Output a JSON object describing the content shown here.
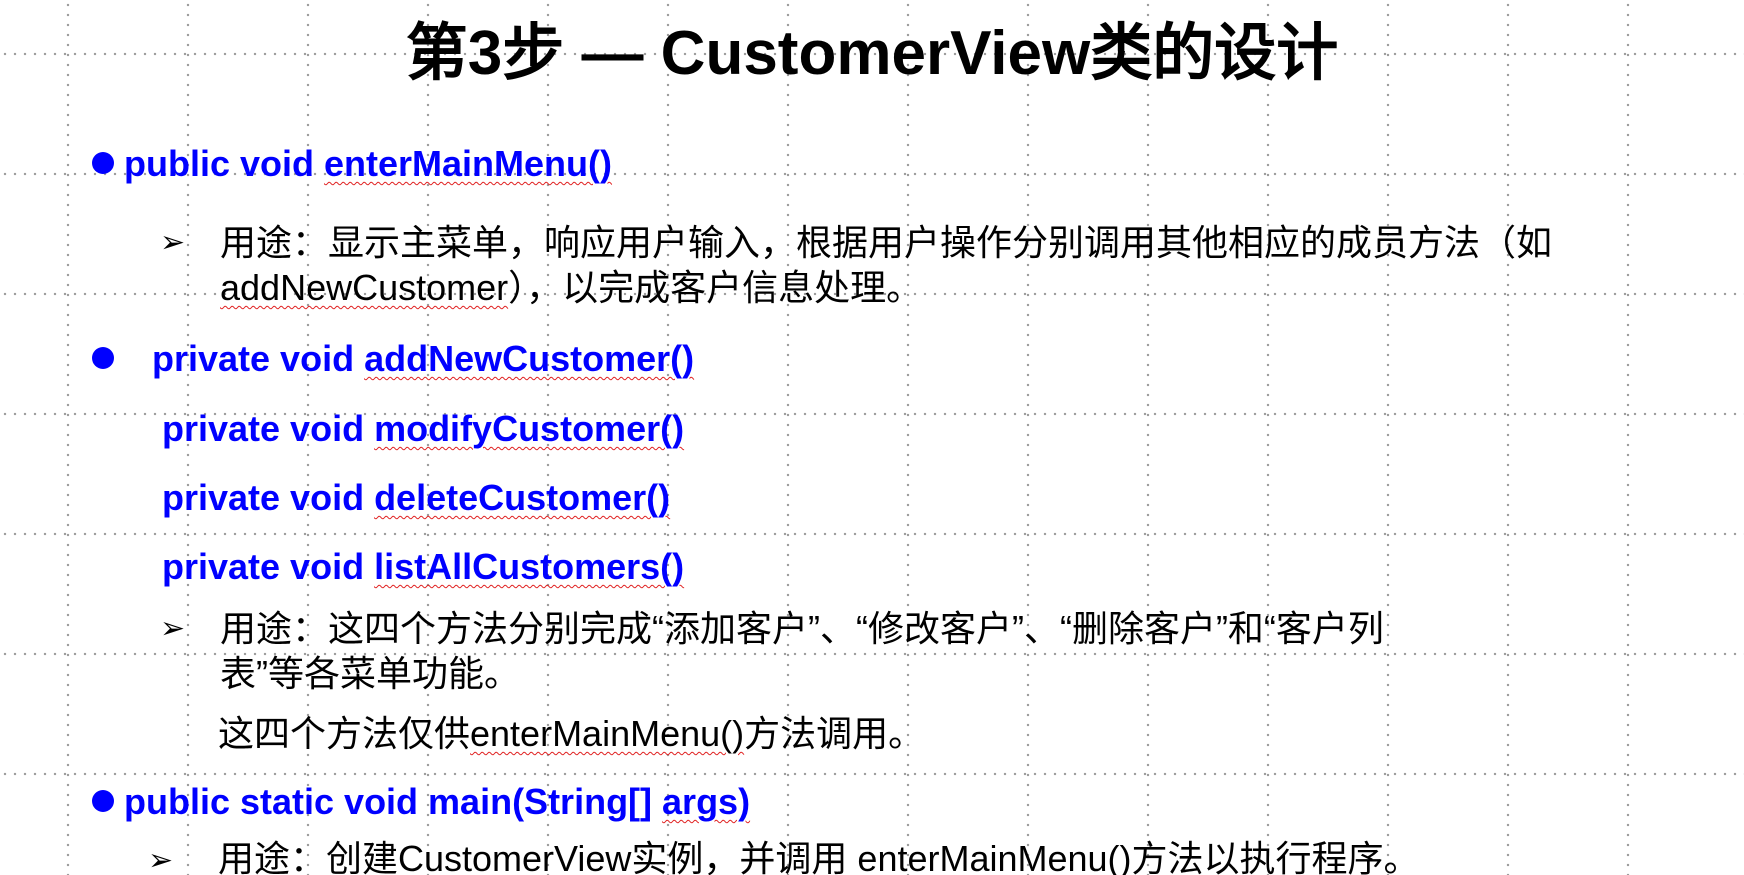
{
  "slide": {
    "title": "第3步 — CustomerView类的设计",
    "bullet1": {
      "prefix": "public void ",
      "method": "enterMainMenu()"
    },
    "bullet1_desc": {
      "line1": "用途：显示主菜单，响应用户输入，根据用户操作分别调用其他相应的成员方法（如",
      "line2_method": "addNewCustomer",
      "line2_rest": "），以完成客户信息处理。"
    },
    "bullet2": {
      "items": [
        {
          "prefix": "private void ",
          "method": "addNewCustomer()"
        },
        {
          "prefix": "private void ",
          "method": "modifyCustomer()"
        },
        {
          "prefix": "private void ",
          "method": "deleteCustomer()"
        },
        {
          "prefix": "private void ",
          "method": "listAllCustomers()"
        }
      ]
    },
    "bullet2_desc": {
      "line1": "用途：这四个方法分别完成“添加客户”、“修改客户”、“删除客户”和“客户列",
      "line2": "表”等各菜单功能。",
      "line3_pre": "这四个方法仅供",
      "line3_method": "enterMainMenu()",
      "line3_post": "方法调用。"
    },
    "bullet3": {
      "prefix": "public static void main(String[] ",
      "method": "args)"
    },
    "bullet3_desc": {
      "line1": "用途：创建CustomerView实例，并调用 enterMainMenu()方法以执行程序。"
    },
    "arrow_glyph": "➢"
  }
}
